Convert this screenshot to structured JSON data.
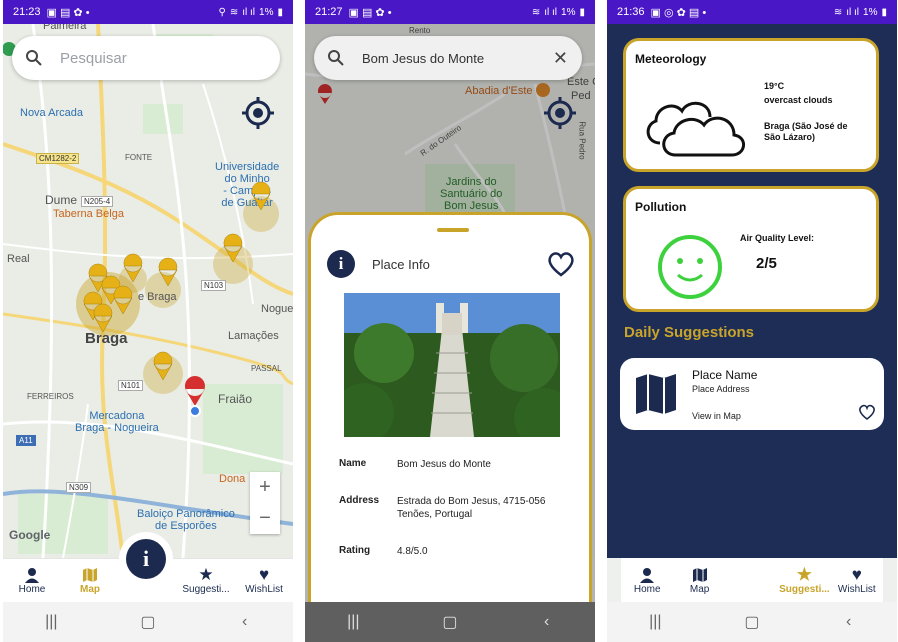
{
  "phone1": {
    "status": {
      "time": "21:23",
      "battery": "1%"
    },
    "search": {
      "placeholder": "Pesquisar"
    },
    "map": {
      "labels": {
        "palmeira": "Palmeira",
        "nova_arcada": "Nova Arcada",
        "fonte": "FONTE",
        "uminho": "Universidade\ndo Minho\n- Campus\nde Gualtar",
        "dume": "Dume",
        "taberna": "Taberna Belga",
        "real": "Real",
        "braga": "Braga",
        "braga_small": "e Braga",
        "nogueira": "Nogue",
        "lamacoes": "Lamações",
        "passal": "PASSAL",
        "ferreiros": "FERREIROS",
        "fraiao": "Fraião",
        "mercadona": "Mercadona\nBraga - Nogueira",
        "dona": "Dona",
        "baloico": "Baloiço Panorâmico\nde Esporões",
        "google": "Google"
      },
      "roads": {
        "cm1282": "CM1282-2",
        "n205": "N205-4",
        "n103": "N103",
        "n101": "N101",
        "n309": "N309",
        "a11": "A11"
      }
    },
    "zoom": {
      "plus": "+",
      "minus": "−"
    },
    "nav": [
      {
        "label": "Home",
        "icon": "person-icon"
      },
      {
        "label": "Map",
        "icon": "map-icon",
        "active": true
      },
      {
        "label": "Suggesti...",
        "icon": "star-icon"
      },
      {
        "label": "WishList",
        "icon": "heart-icon"
      }
    ],
    "fab": "i"
  },
  "phone2": {
    "status": {
      "time": "21:27",
      "battery": "1%"
    },
    "search": {
      "value": "Bom Jesus do Monte"
    },
    "map": {
      "labels": {
        "abadia": "Abadia d'Este",
        "este": "Este C",
        "ped": "Ped",
        "outeiro": "R. do Outeiro",
        "jardins": "Jardins do\nSantuário do\nBom Jesus",
        "rento": "Rento",
        "ruapedro": "Rua Pedro"
      }
    },
    "sheet": {
      "title": "Place Info",
      "rows": [
        {
          "key": "Name",
          "value": "Bom Jesus do Monte"
        },
        {
          "key": "Address",
          "value": "Estrada do Bom Jesus, 4715-056\nTenões, Portugal"
        },
        {
          "key": "Rating",
          "value": "4.8/5.0"
        }
      ]
    }
  },
  "phone3": {
    "status": {
      "time": "21:36",
      "battery": "1%"
    },
    "meteorology": {
      "title": "Meteorology",
      "temp": "19°C",
      "description": "overcast clouds",
      "location": "Braga (São José de\nSão Lázaro)"
    },
    "pollution": {
      "title": "Pollution",
      "aq_label": "Air Quality Level:",
      "aq_value": "2/5"
    },
    "daily": {
      "title": "Daily Suggestions",
      "place_name": "Place Name",
      "place_address": "Place Address",
      "view_link": "View in Map"
    },
    "nav": [
      {
        "label": "Home",
        "icon": "person-icon"
      },
      {
        "label": "Map",
        "icon": "map-icon"
      },
      {
        "label": "Suggesti...",
        "icon": "star-icon",
        "active": true
      },
      {
        "label": "WishList",
        "icon": "heart-icon"
      }
    ]
  },
  "colors": {
    "status_bar": "#4a17c6",
    "navy": "#1b2a4e",
    "gold": "#c9a42b",
    "bg_dark": "#1d2d56",
    "smile_green": "#3ed13e"
  }
}
